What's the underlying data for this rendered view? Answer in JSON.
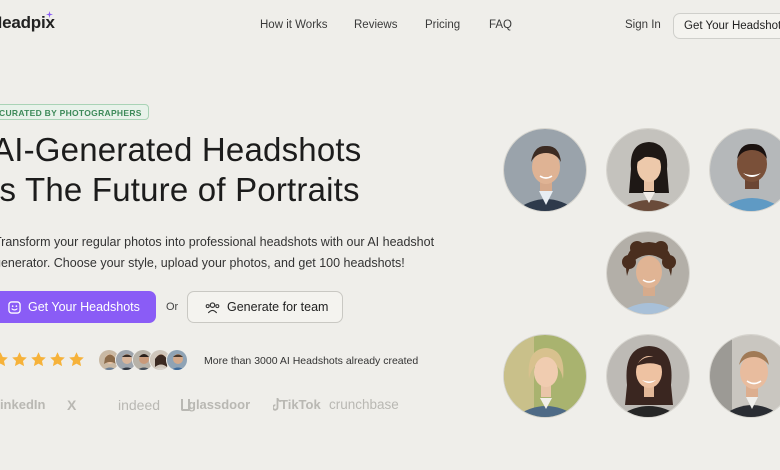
{
  "nav": {
    "logo": "Headpix",
    "links": [
      "How it Works",
      "Reviews",
      "Pricing",
      "FAQ"
    ],
    "sign_in": "Sign In",
    "cta": "Get Your Headshots"
  },
  "hero": {
    "badge": "CURATED BY PHOTOGRAPHERS",
    "headline_line1": "AI-Generated Headshots",
    "headline_line2": "is The Future of Portraits",
    "subtext_line1": "Transform your regular photos into professional headshots with our AI headshot",
    "subtext_line2": "generator. Choose your style, upload your photos, and get 100 headshots!",
    "primary_button": "Get Your Headshots",
    "or_label": "Or",
    "secondary_button": "Generate for team",
    "rating_stars": 5,
    "social_proof": "More than 3000 AI Headshots already created"
  },
  "brands": [
    "LinkedIn",
    "X",
    "indeed",
    "glassdoor",
    "TikTok",
    "crunchbase"
  ],
  "colors": {
    "background": "#efeeea",
    "primary": "#8a5cf6",
    "badge_green": "#3d8a59",
    "star": "#f6b23a",
    "brand_gray": "#b9b8b3"
  }
}
